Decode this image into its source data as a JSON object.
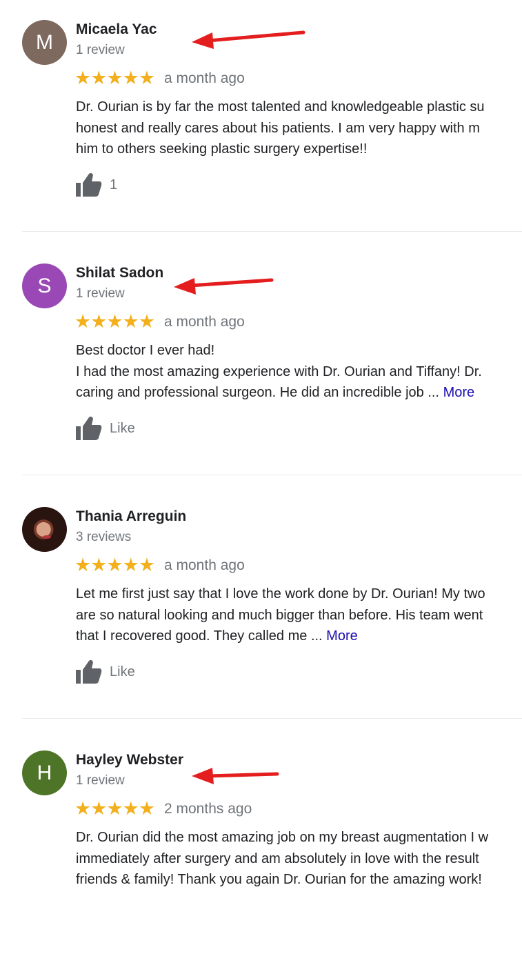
{
  "reviews": [
    {
      "name": "Micaela Yac",
      "review_count": "1 review",
      "avatar_letter": "M",
      "avatar_color": "#7d695e",
      "rating": 5,
      "stars": "★★★★★",
      "date": "a month ago",
      "lines": [
        "Dr. Ourian is by far the most talented and knowledgeable plastic su",
        "honest and really cares about his patients. I am very happy with m",
        "him to others seeking plastic surgery expertise!!"
      ],
      "more": "",
      "likes": "1",
      "icon": "thumbs-up-icon"
    },
    {
      "name": "Shilat Sadon",
      "review_count": "1 review",
      "avatar_letter": "S",
      "avatar_color": "#9a48b6",
      "rating": 5,
      "stars": "★★★★★",
      "date": "a month ago",
      "lines": [
        "Best doctor I ever had!",
        "I had the most amazing experience with Dr. Ourian and Tiffany! Dr.",
        "caring and professional surgeon. He did an incredible job ..."
      ],
      "more": "More",
      "likes": "Like",
      "icon": "thumbs-up-icon"
    },
    {
      "name": "Thania Arreguin",
      "review_count": "3 reviews",
      "avatar_letter": "",
      "avatar_color": "#2a1410",
      "rating": 5,
      "stars": "★★★★★",
      "date": "a month ago",
      "lines": [
        "Let me first just say that I love the work done by Dr. Ourian! My two",
        "are so natural looking and much bigger than before. His team went",
        "that I recovered good. They called me ..."
      ],
      "more": "More",
      "likes": "Like",
      "icon": "thumbs-up-icon"
    },
    {
      "name": "Hayley Webster",
      "review_count": "1 review",
      "avatar_letter": "H",
      "avatar_color": "#4e7427",
      "rating": 5,
      "stars": "★★★★★",
      "date": "2 months ago",
      "lines": [
        "Dr. Ourian did the most amazing job on my breast augmentation I w",
        "immediately after surgery and am absolutely in love with the result",
        "friends & family! Thank you again Dr. Ourian for the amazing work!"
      ],
      "more": "",
      "likes": "",
      "icon": "thumbs-up-icon"
    }
  ],
  "colors": {
    "star": "#f3b01c",
    "annotation_arrow": "#e41e1e",
    "more_link": "#1a0dab",
    "secondary_text": "#70757a"
  }
}
